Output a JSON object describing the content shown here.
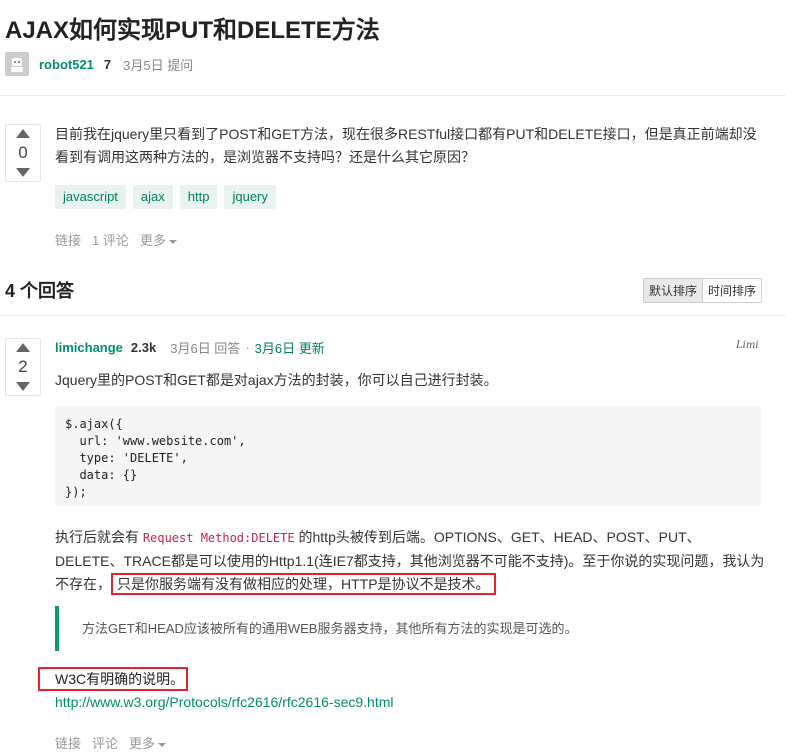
{
  "question": {
    "title": "AJAX如何实现PUT和DELETE方法",
    "author": {
      "name": "robot521",
      "rep": "7"
    },
    "meta": "3月5日 提问",
    "votes": "0",
    "body": "目前我在jquery里只看到了POST和GET方法，现在很多RESTful接口都有PUT和DELETE接口，但是真正前端却没看到有调用这两种方法的，是浏览器不支持吗？还是什么其它原因？",
    "tags": [
      "javascript",
      "ajax",
      "http",
      "jquery"
    ],
    "actions": {
      "link": "链接",
      "comment": "1 评论",
      "more": "更多"
    }
  },
  "answers_header": {
    "count_label": "4 个回答"
  },
  "sort": {
    "default_label": "默认排序",
    "time_label": "时间排序"
  },
  "answer": {
    "author": {
      "name": "limichange",
      "rep": "2.3k"
    },
    "answered": "3月6日 回答",
    "separator": "·",
    "updated": "3月6日 更新",
    "signature": "Limi",
    "votes": "2",
    "intro": "Jquery里的POST和GET都是对ajax方法的封装，你可以自己进行封装。",
    "code": "$.ajax({\n  url: 'www.website.com',\n  type: 'DELETE',\n  data: {}\n});",
    "p2_before": "执行后就会有 ",
    "p2_code": "Request Method:DELETE",
    "p2_after": " 的http头被传到后端。OPTIONS、GET、HEAD、POST、PUT、DELETE、TRACE都是可以使用的Http1.1(连IE7都支持，其他浏览器不可能不支持)。至于你说的实现问题，我认为不存在，",
    "p2_highlight": "只是你服务端有没有做相应的处理，HTTP是协议不是技术。",
    "quote": "方法GET和HEAD应该被所有的通用WEB服务器支持，其他所有方法的实现是可选的。",
    "w3c": "W3C有明确的说明。",
    "link": "http://www.w3.org/Protocols/rfc2616/rfc2616-sec9.html",
    "actions": {
      "link": "链接",
      "comment": "评论",
      "more": "更多"
    }
  },
  "colors": {
    "accent": "#018e6a",
    "highlight_border": "#e8222a",
    "quote_border": "#0a9b75"
  }
}
